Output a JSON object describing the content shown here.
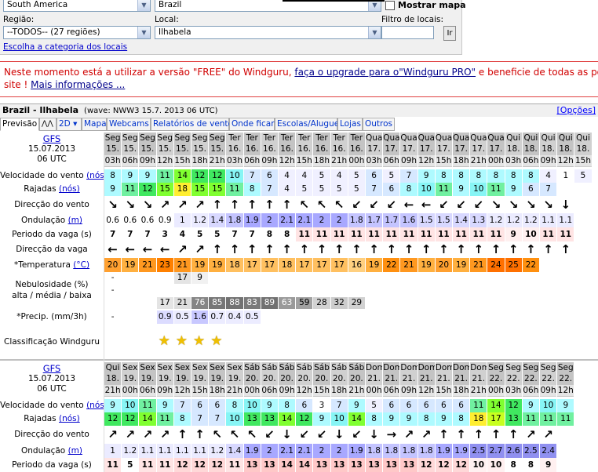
{
  "form": {
    "continent_value": "South America",
    "country_value": "Brazil",
    "show_map_label": "Mostrar mapa",
    "region_label": "Região:",
    "region_value": "--TODOS-- (27 regiões)",
    "local_label": "Local:",
    "local_value": "Ilhabela",
    "filter_label": "Filtro de locais:",
    "filter_value": "",
    "filter_button": "Ir",
    "category_link": "Escolha a categoria dos locais"
  },
  "message": {
    "line1_a": "Neste momento está a utilizar a versão \"FREE\" do Windguru, ",
    "line1_link": "faça o upgrade para o\"Windguru PRO\"",
    "line1_b": " e beneficie de todas as potencialidades deste",
    "line2_a": "site ! ",
    "line2_link": "Mais informações ..."
  },
  "forecast_header": {
    "title": "Brazil - Ilhabela",
    "wave": "(wave: NWW3 15.7. 2013 06 UTC)",
    "options": "[Opções]"
  },
  "tabs": [
    "Previsão",
    "",
    "2D",
    "Mapa",
    "Webcams",
    "Relatórios de vento",
    "Onde ficar",
    "Escolas/Aluguer",
    "Lojas",
    "Outros"
  ],
  "labels": {
    "wind_speed": "Velocidade do vento ",
    "gusts": "Rajadas ",
    "knots": "(nós)",
    "wind_dir": "Direcção do vento",
    "wave": "Ondulação ",
    "meters": "(m)",
    "period": "Periodo da vaga (s)",
    "wave_dir": "Direcção da vaga",
    "temp": "*Temperatura ",
    "celsius": "(°C)",
    "cloud1": "Nebulosidade (%)",
    "cloud2": "alta / média / baixa",
    "precip": "*Precip. (mm/3h)",
    "rating": "Classificação Windguru"
  },
  "block1": {
    "model": "GFS",
    "date": "15.07.2013",
    "utc": "06 UTC",
    "days": [
      "Seg",
      "Seg",
      "Seg",
      "Seg",
      "Seg",
      "Seg",
      "Seg",
      "Ter",
      "Ter",
      "Ter",
      "Ter",
      "Ter",
      "Ter",
      "Ter",
      "Ter",
      "Qua",
      "Qua",
      "Qua",
      "Qua",
      "Qua",
      "Qua",
      "Qua",
      "Qua",
      "Qui",
      "Qui",
      "Qui",
      "Qui",
      "Qui"
    ],
    "dates": [
      "15.",
      "15.",
      "15.",
      "15.",
      "15.",
      "15.",
      "15.",
      "16.",
      "16.",
      "16.",
      "16.",
      "16.",
      "16.",
      "16.",
      "16.",
      "17.",
      "17.",
      "17.",
      "17.",
      "17.",
      "17.",
      "17.",
      "17.",
      "18.",
      "18.",
      "18.",
      "18.",
      "18."
    ],
    "hours": [
      "03h",
      "06h",
      "09h",
      "12h",
      "15h",
      "18h",
      "21h",
      "03h",
      "06h",
      "09h",
      "12h",
      "15h",
      "18h",
      "21h",
      "00h",
      "03h",
      "06h",
      "09h",
      "12h",
      "15h",
      "18h",
      "21h",
      "00h",
      "03h",
      "06h",
      "09h",
      "12h",
      "15h"
    ],
    "wind": [
      "8",
      "9",
      "9",
      "11",
      "14",
      "12",
      "12",
      "10",
      "7",
      "6",
      "4",
      "4",
      "5",
      "4",
      "5",
      "6",
      "5",
      "7",
      "9",
      "8",
      "8",
      "8",
      "8",
      "8",
      "8",
      "4",
      "1",
      "5"
    ],
    "gust": [
      "9",
      "11",
      "12",
      "15",
      "18",
      "15",
      "15",
      "11",
      "8",
      "7",
      "4",
      "5",
      "5",
      "5",
      "5",
      "7",
      "6",
      "8",
      "10",
      "11",
      "9",
      "10",
      "11",
      "9",
      "6",
      "7",
      "",
      ""
    ],
    "wdir": [
      "↘",
      "↘",
      "↘",
      "↗",
      "↗",
      "↗",
      "↑",
      "↑",
      "↑",
      "↑",
      "↑",
      "↖",
      "↖",
      "↖",
      "↙",
      "↙",
      "↙",
      "←",
      "←",
      "↙",
      "↙",
      "↙",
      "↘",
      "↘",
      "↘",
      "↘",
      "↓",
      ""
    ],
    "wave": [
      "0.6",
      "0.6",
      "0.6",
      "0.9",
      "1",
      "1.2",
      "1.4",
      "1.8",
      "1.9",
      "2",
      "2.1",
      "2.1",
      "2",
      "2",
      "1.8",
      "1.7",
      "1.7",
      "1.6",
      "1.5",
      "1.5",
      "1.4",
      "1.3",
      "1.2",
      "1.2",
      "1.2",
      "1.1",
      "1.1",
      ""
    ],
    "period": [
      "7",
      "7",
      "7",
      "3",
      "4",
      "5",
      "5",
      "7",
      "7",
      "8",
      "8",
      "11",
      "11",
      "11",
      "11",
      "11",
      "11",
      "11",
      "11",
      "11",
      "11",
      "11",
      "11",
      "9",
      "10",
      "11",
      "11",
      ""
    ],
    "wavedir": [
      "←",
      "←",
      "←",
      "←",
      "↗",
      "↗",
      "↑",
      "↑",
      "↑",
      "↑",
      "↑",
      "↑",
      "↑",
      "↑",
      "↑",
      "↑",
      "↑",
      "↑",
      "↑",
      "↑",
      "↑",
      "↑",
      "↑",
      "↑",
      "↑",
      "↑",
      "↑",
      ""
    ],
    "temp": [
      "20",
      "19",
      "21",
      "23",
      "21",
      "19",
      "19",
      "18",
      "17",
      "17",
      "18",
      "17",
      "17",
      "17",
      "16",
      "19",
      "22",
      "21",
      "19",
      "20",
      "19",
      "21",
      "24",
      "25",
      "22",
      "",
      "",
      ""
    ],
    "cloud_high": [
      "-",
      "",
      "",
      "",
      "17",
      "9"
    ],
    "cloud_mid": [
      "-"
    ],
    "cloud_low": [
      "17",
      "21",
      "76",
      "85",
      "88",
      "83",
      "89",
      "63",
      "59",
      "28",
      "32",
      "29"
    ],
    "precip": [
      "-",
      "",
      "",
      "0.9",
      "0.5",
      "1.6",
      "0.7",
      "0.4",
      "0.5"
    ],
    "stars": [
      "★",
      "★",
      "★",
      "★"
    ]
  },
  "block2": {
    "model": "GFS",
    "date": "15.07.2013",
    "utc": "06 UTC",
    "days": [
      "Qui",
      "Sex",
      "Sex",
      "Sex",
      "Sex",
      "Sex",
      "Sex",
      "Sex",
      "Sáb",
      "Sáb",
      "Sáb",
      "Sáb",
      "Sáb",
      "Sáb",
      "Sáb",
      "Dom",
      "Dom",
      "Dom",
      "Dom",
      "Dom",
      "Dom",
      "Dom",
      "Seg",
      "Seg",
      "Seg",
      "Seg",
      "Seg"
    ],
    "dates": [
      "18.",
      "19.",
      "19.",
      "19.",
      "19.",
      "19.",
      "19.",
      "19.",
      "20.",
      "20.",
      "20.",
      "20.",
      "20.",
      "20.",
      "20.",
      "21.",
      "21.",
      "21.",
      "21.",
      "21.",
      "21.",
      "21.",
      "22.",
      "22.",
      "22.",
      "22.",
      "22."
    ],
    "hours": [
      "21h",
      "00h",
      "06h",
      "09h",
      "12h",
      "15h",
      "18h",
      "21h",
      "00h",
      "06h",
      "09h",
      "12h",
      "15h",
      "18h",
      "21h",
      "00h",
      "06h",
      "09h",
      "12h",
      "15h",
      "18h",
      "21h",
      "00h",
      "03h",
      "06h",
      "09h",
      "12h"
    ],
    "wind": [
      "9",
      "10",
      "11",
      "9",
      "7",
      "6",
      "6",
      "8",
      "10",
      "9",
      "8",
      "6",
      "3",
      "7",
      "9",
      "5",
      "6",
      "6",
      "6",
      "6",
      "6",
      "11",
      "14",
      "12",
      "9",
      "10",
      "9"
    ],
    "gust": [
      "12",
      "12",
      "14",
      "11",
      "8",
      "7",
      "7",
      "10",
      "13",
      "13",
      "14",
      "12",
      "9",
      "10",
      "14",
      "8",
      "9",
      "9",
      "8",
      "9",
      "8",
      "18",
      "17",
      "13",
      "11",
      "11",
      "11"
    ],
    "wdir": [
      "↗",
      "↗",
      "↗",
      "↗",
      "↑",
      "↑",
      "↖",
      "↖",
      "↖",
      "↙",
      "↓",
      "↙",
      "↙",
      "↓",
      "↙",
      "↓",
      "→",
      "↗",
      "↗",
      "↑",
      "↑",
      "↑",
      "↑",
      "↑",
      "↗",
      "↗",
      ""
    ],
    "wave": [
      "1",
      "1.2",
      "1.1",
      "1.1",
      "1.1",
      "1.1",
      "1.2",
      "1.4",
      "1.9",
      "2",
      "2.1",
      "2.1",
      "2",
      "2",
      "1.9",
      "1.8",
      "1.8",
      "1.8",
      "1.8",
      "1.9",
      "1.9",
      "2.5",
      "2.7",
      "2.6",
      "2.5",
      "2.4",
      ""
    ],
    "period": [
      "11",
      "5",
      "11",
      "11",
      "12",
      "12",
      "12",
      "11",
      "13",
      "13",
      "14",
      "14",
      "13",
      "13",
      "13",
      "13",
      "13",
      "13",
      "12",
      "12",
      "12",
      "10",
      "10",
      "8",
      "8",
      "9",
      ""
    ]
  }
}
